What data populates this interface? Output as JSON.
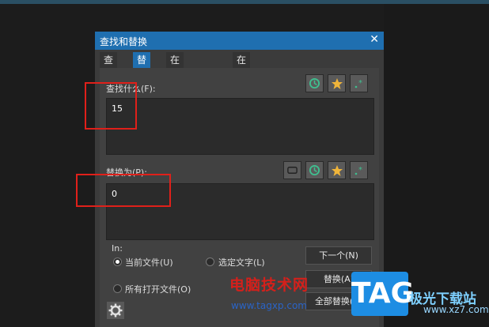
{
  "dialog": {
    "title": "查找和替换",
    "tabs": [
      {
        "label": "查找"
      },
      {
        "label": "替换"
      },
      {
        "label": "在文件中查找"
      },
      {
        "label": "在文件中替换"
      }
    ],
    "active_tab": "替换",
    "find_label": "查找什么(F):",
    "find_value": "15",
    "replace_label": "替换为(P):",
    "replace_value": "0",
    "in_label": "In:",
    "scope_options": [
      {
        "label": "当前文件(U)",
        "selected": true
      },
      {
        "label": "选定文字(L)",
        "selected": false
      },
      {
        "label": "所有打开文件(O)",
        "selected": false
      }
    ],
    "buttons": {
      "next": "下一个(N)",
      "replace": "替换(A)",
      "replace_all": "全部替换(A)"
    },
    "icons": [
      "history-icon",
      "star-icon",
      "regex-icon",
      "swap-icon",
      "gear-icon"
    ]
  },
  "watermark": {
    "site_name": "电脑技术网",
    "site_url": "www.tagxp.com",
    "logo_text": "TAG",
    "brand": "极光下载站",
    "brand_url": "www.xz7.com"
  },
  "colors": {
    "accent": "#1f6fb0",
    "highlight_box": "#e0201a",
    "star": "#f0b53a",
    "history": "#3fbf8f"
  }
}
